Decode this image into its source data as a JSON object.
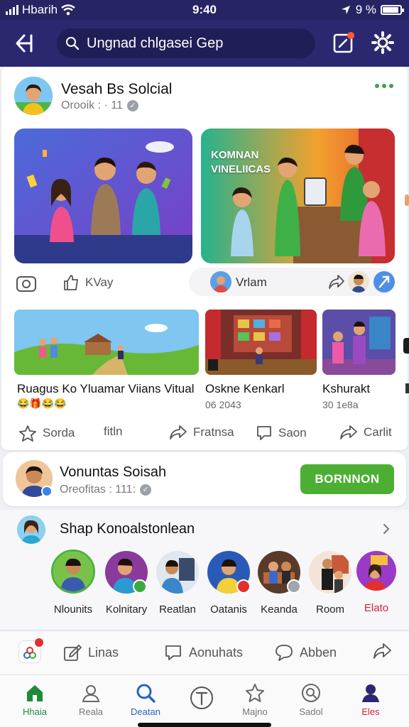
{
  "status_bar": {
    "carrier": "Hbarih",
    "time": "9:40",
    "battery_text": "9 %",
    "battery_level": 0.9
  },
  "top_bar": {
    "search_placeholder": "Ungnad chlgasei Gep",
    "icons": [
      "back-arrow-icon",
      "search-icon",
      "share-icon",
      "gear-icon"
    ],
    "colors": {
      "bar": "#2b2870",
      "status": "#272463"
    }
  },
  "post": {
    "author": "Vesah Bs Solcial",
    "meta": "Orooik : · 11",
    "featured_title": "KOMNAN VINELIICAS",
    "actions": {
      "left_label": "KVay",
      "center_label": "Vrlam"
    }
  },
  "media_row": [
    {
      "title": "Ruagus Ko Yluamar Viians Vitual",
      "meta": "😂🎁😂😂"
    },
    {
      "title": "Oskne Kenkarl",
      "meta": "06 2043"
    },
    {
      "title": "Kshurakt",
      "meta": "30 1e8a"
    }
  ],
  "post_actions": [
    {
      "label": "Sorda",
      "icon": "star-icon"
    },
    {
      "label": "fitln",
      "icon": "none"
    },
    {
      "label": "Fratnsa",
      "icon": "share-arrow-icon"
    },
    {
      "label": "Saon",
      "icon": "comment-icon"
    },
    {
      "label": "Carlit",
      "icon": "share-arrow-icon"
    }
  ],
  "profile_card": {
    "name": "Vonuntas Soisah",
    "meta": "Oreofitas : 111:",
    "button_label": "BORNNON",
    "button_color": "#4caf34"
  },
  "stories": {
    "title": "Shap Konoalstonlean",
    "items": [
      {
        "label": "Nlounits",
        "color": "#222"
      },
      {
        "label": "Kolnitary",
        "color": "#222"
      },
      {
        "label": "Reatlan",
        "color": "#222"
      },
      {
        "label": "Oatanis",
        "color": "#222"
      },
      {
        "label": "Keanda",
        "color": "#222"
      },
      {
        "label": "Room",
        "color": "#222"
      },
      {
        "label": "Elato",
        "color": "#d2213b"
      }
    ]
  },
  "action_bar": {
    "items": [
      {
        "label": "Linas"
      },
      {
        "label": "Aonuhats"
      },
      {
        "label": "Abben"
      }
    ]
  },
  "bottom_nav": {
    "items": [
      {
        "label": "Hhaia",
        "icon": "home-icon",
        "color": "#1f8a3a"
      },
      {
        "label": "Reala",
        "icon": "user-icon",
        "color": "#777"
      },
      {
        "label": "Deatan",
        "icon": "search-icon",
        "color": "#2565c2"
      },
      {
        "label": "",
        "icon": "text-circle-icon",
        "color": "#555"
      },
      {
        "label": "Majno",
        "icon": "star-icon",
        "color": "#777"
      },
      {
        "label": "Sadol",
        "icon": "search-circle-icon",
        "color": "#777"
      },
      {
        "label": "Eles",
        "icon": "profile-icon",
        "color": "#d2213b"
      }
    ]
  }
}
